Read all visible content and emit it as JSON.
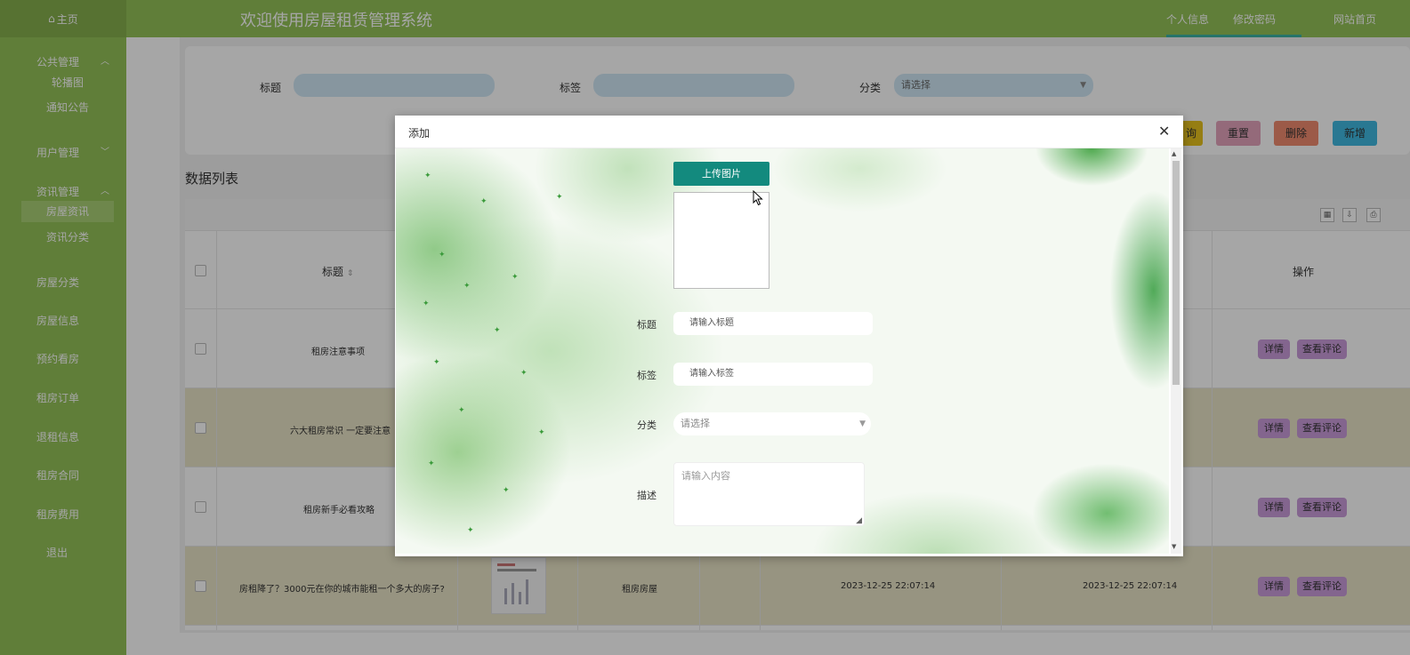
{
  "topbar": {
    "home": "主页",
    "title": "欢迎使用房屋租赁管理系统",
    "links": [
      "个人信息",
      "修改密码",
      "网站首页"
    ]
  },
  "sidebar": {
    "groups": [
      {
        "label": "公共管理",
        "children": [
          "轮播图",
          "通知公告"
        ]
      },
      {
        "label": "用户管理"
      },
      {
        "label": "资讯管理",
        "children": [
          "房屋资讯",
          "资讯分类"
        ]
      }
    ],
    "items": [
      "房屋分类",
      "房屋信息",
      "预约看房",
      "租房订单",
      "退租信息",
      "租房合同",
      "租房费用",
      "退出"
    ]
  },
  "search": {
    "title_label": "标题",
    "tag_label": "标签",
    "category_label": "分类",
    "category_placeholder": "请选择"
  },
  "actions": {
    "query_partial": "询",
    "reset": "重置",
    "delete": "删除",
    "add": "新增"
  },
  "list": {
    "heading": "数据列表",
    "col_title": "标题",
    "col_ops": "操作",
    "rows": [
      {
        "title": "租房注意事项"
      },
      {
        "title": "六大租房常识 一定要注意"
      },
      {
        "title": "租房新手必看攻略"
      },
      {
        "title": "房租降了？3000元在你的城市能租一个多大的房子?",
        "category": "租房房屋",
        "created": "2023-12-25 22:07:14",
        "updated": "2023-12-25 22:07:14"
      }
    ],
    "detail_btn": "详情",
    "comments_btn": "查看评论"
  },
  "modal": {
    "title": "添加",
    "upload_btn": "上传图片",
    "title_label": "标题",
    "title_placeholder": "请输入标题",
    "tag_label": "标签",
    "tag_placeholder": "请输入标签",
    "category_label": "分类",
    "category_placeholder": "请选择",
    "desc_label": "描述",
    "desc_placeholder": "请输入内容"
  },
  "colors": {
    "green": "#94c258",
    "teal": "#138a7e",
    "purple": "#c99bdb"
  }
}
